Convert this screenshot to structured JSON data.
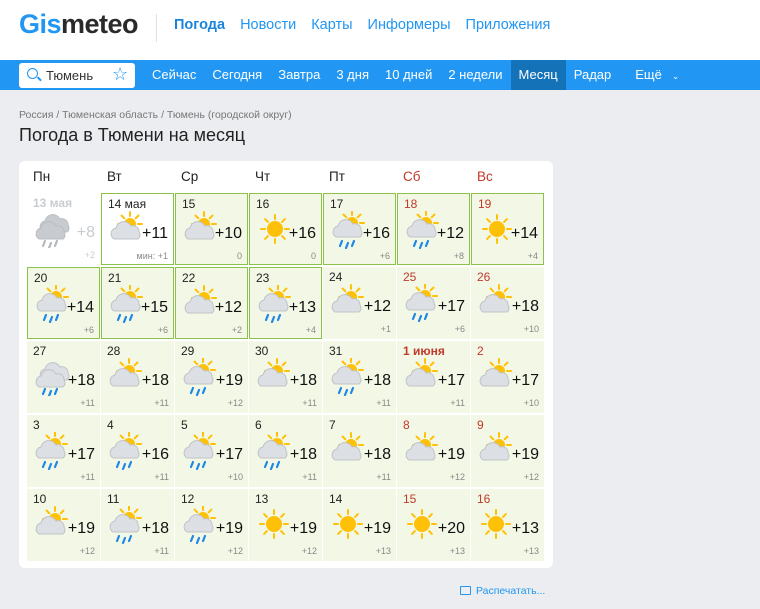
{
  "header": {
    "logo": {
      "part1": "Gis",
      "part2": "meteo"
    },
    "nav": [
      "Погода",
      "Новости",
      "Карты",
      "Информеры",
      "Приложения"
    ]
  },
  "search": {
    "value": "Тюмень"
  },
  "subnav": [
    "Сейчас",
    "Сегодня",
    "Завтра",
    "3 дня",
    "10 дней",
    "2 недели",
    "Месяц",
    "Радар",
    "Ещё"
  ],
  "breadcrumb": "Россия / Тюменская область / Тюмень (городской округ)",
  "page_title": "Погода в Тюмени на месяц",
  "weekdays": [
    "Пн",
    "Вт",
    "Ср",
    "Чт",
    "Пт",
    "Сб",
    "Вс"
  ],
  "days": [
    {
      "d": "13 мая",
      "hi": "+8",
      "lo": "+2",
      "icon": "cloud-rain",
      "past": true
    },
    {
      "d": "14 мая",
      "hi": "+11",
      "lo": "мин: +1",
      "icon": "sun-cloud",
      "today": true
    },
    {
      "d": "15",
      "hi": "+10",
      "lo": "0",
      "icon": "sun-cloud",
      "hl": true
    },
    {
      "d": "16",
      "hi": "+16",
      "lo": "0",
      "icon": "sun",
      "hl": true
    },
    {
      "d": "17",
      "hi": "+16",
      "lo": "+6",
      "icon": "sun-cloud-rain",
      "hl": true
    },
    {
      "d": "18",
      "hi": "+12",
      "lo": "+8",
      "icon": "sun-cloud-rain",
      "we": true,
      "hl": true
    },
    {
      "d": "19",
      "hi": "+14",
      "lo": "+4",
      "icon": "sun",
      "we": true,
      "hl": true
    },
    {
      "d": "20",
      "hi": "+14",
      "lo": "+6",
      "icon": "sun-cloud-rain",
      "hl": true
    },
    {
      "d": "21",
      "hi": "+15",
      "lo": "+6",
      "icon": "sun-cloud-rain",
      "hl": true
    },
    {
      "d": "22",
      "hi": "+12",
      "lo": "+2",
      "icon": "sun-cloud",
      "hl": true
    },
    {
      "d": "23",
      "hi": "+13",
      "lo": "+4",
      "icon": "sun-cloud-rain",
      "hl": true
    },
    {
      "d": "24",
      "hi": "+12",
      "lo": "+1",
      "icon": "sun-cloud"
    },
    {
      "d": "25",
      "hi": "+17",
      "lo": "+6",
      "icon": "sun-cloud-rain",
      "we": true
    },
    {
      "d": "26",
      "hi": "+18",
      "lo": "+10",
      "icon": "sun-cloud",
      "we": true
    },
    {
      "d": "27",
      "hi": "+18",
      "lo": "+11",
      "icon": "cloud-rain"
    },
    {
      "d": "28",
      "hi": "+18",
      "lo": "+11",
      "icon": "sun-cloud"
    },
    {
      "d": "29",
      "hi": "+19",
      "lo": "+12",
      "icon": "sun-cloud-rain"
    },
    {
      "d": "30",
      "hi": "+18",
      "lo": "+11",
      "icon": "sun-cloud"
    },
    {
      "d": "31",
      "hi": "+18",
      "lo": "+11",
      "icon": "sun-cloud-rain"
    },
    {
      "d": "1 июня",
      "hi": "+17",
      "lo": "+11",
      "icon": "sun-cloud",
      "we": true,
      "bold": true
    },
    {
      "d": "2",
      "hi": "+17",
      "lo": "+10",
      "icon": "sun-cloud",
      "we": true
    },
    {
      "d": "3",
      "hi": "+17",
      "lo": "+11",
      "icon": "sun-cloud-rain"
    },
    {
      "d": "4",
      "hi": "+16",
      "lo": "+11",
      "icon": "sun-cloud-rain"
    },
    {
      "d": "5",
      "hi": "+17",
      "lo": "+10",
      "icon": "sun-cloud-rain"
    },
    {
      "d": "6",
      "hi": "+18",
      "lo": "+11",
      "icon": "sun-cloud-rain"
    },
    {
      "d": "7",
      "hi": "+18",
      "lo": "+11",
      "icon": "sun-cloud"
    },
    {
      "d": "8",
      "hi": "+19",
      "lo": "+12",
      "icon": "sun-cloud",
      "we": true
    },
    {
      "d": "9",
      "hi": "+19",
      "lo": "+12",
      "icon": "sun-cloud",
      "we": true
    },
    {
      "d": "10",
      "hi": "+19",
      "lo": "+12",
      "icon": "sun-cloud"
    },
    {
      "d": "11",
      "hi": "+18",
      "lo": "+11",
      "icon": "sun-cloud-rain"
    },
    {
      "d": "12",
      "hi": "+19",
      "lo": "+12",
      "icon": "sun-cloud-rain"
    },
    {
      "d": "13",
      "hi": "+19",
      "lo": "+12",
      "icon": "sun"
    },
    {
      "d": "14",
      "hi": "+19",
      "lo": "+13",
      "icon": "sun"
    },
    {
      "d": "15",
      "hi": "+20",
      "lo": "+13",
      "icon": "sun",
      "we": true
    },
    {
      "d": "16",
      "hi": "+13",
      "lo": "+13",
      "icon": "sun",
      "we": true
    }
  ],
  "print_link": "Распечатать...",
  "colors": {
    "accent": "#2196f3",
    "weekend": "#c0392b",
    "cell_bg": "#f3f8e6",
    "highlight_border": "#8bc34a"
  }
}
